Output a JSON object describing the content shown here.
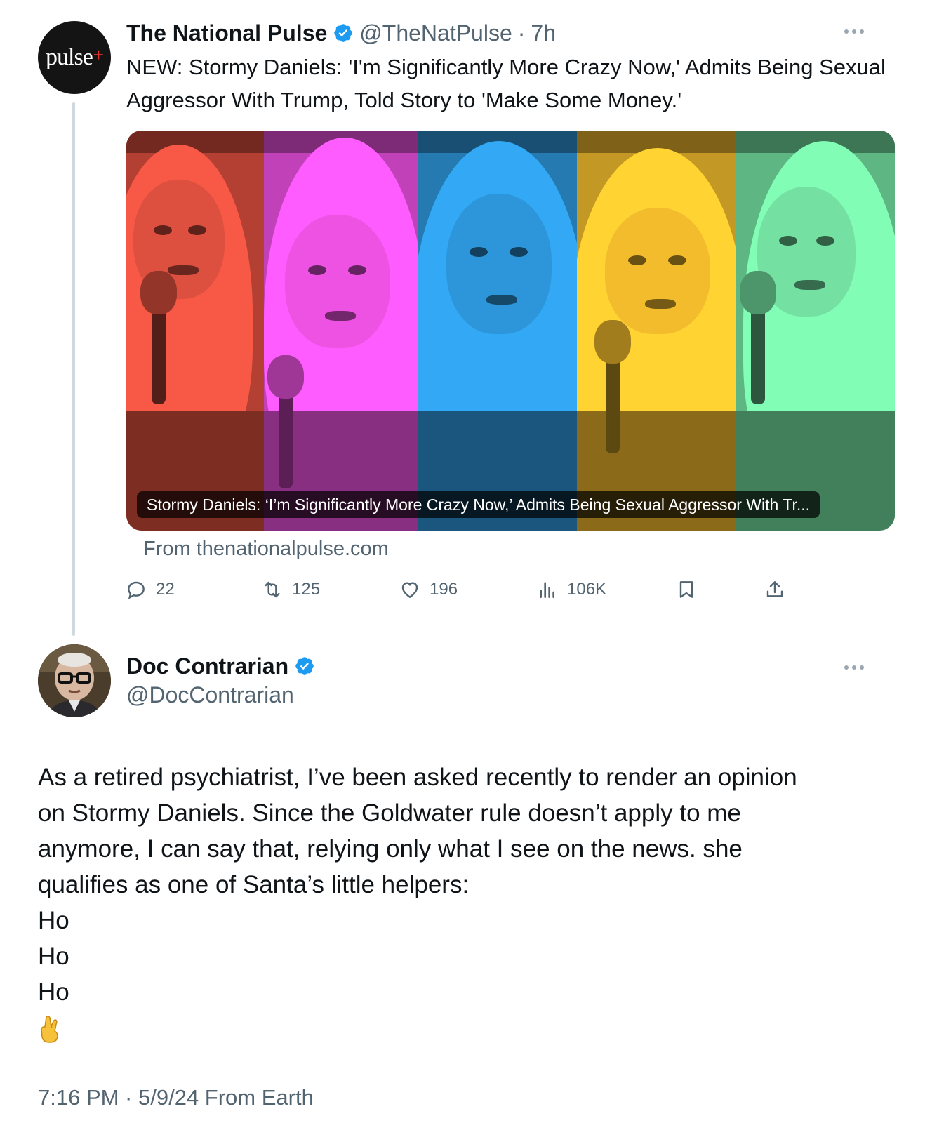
{
  "parent_tweet": {
    "avatar_text": "pulse",
    "avatar_plus": "+",
    "display_name": "The National Pulse",
    "handle": "@TheNatPulse",
    "separator": "·",
    "time": "7h",
    "text": "NEW: Stormy Daniels: 'I'm Significantly More Crazy Now,' Admits Being Sexual Aggressor With Trump, Told Story to 'Make Some Money.'",
    "card": {
      "caption": "Stormy Daniels: ‘I’m Significantly More Crazy Now,’ Admits Being Sexual Aggressor With Tr...",
      "source": "From thenationalpulse.com",
      "panel_colors": [
        "#d24b3b",
        "#e34ed8",
        "#2b8fd0",
        "#e7b32a",
        "#6ed69a"
      ]
    },
    "actions": {
      "replies": "22",
      "reposts": "125",
      "likes": "196",
      "views": "106K"
    }
  },
  "reply_tweet": {
    "display_name": "Doc Contrarian",
    "handle": "@DocContrarian",
    "lines": [
      "As a retired psychiatrist, I’ve been asked recently to render an opinion",
      "on Stormy Daniels. Since the Goldwater rule doesn’t apply to me",
      "anymore, I can say that, relying only what I see on the news. she",
      "qualifies as one of Santa’s little helpers:",
      "Ho",
      "Ho",
      "Ho"
    ],
    "emoji": "🤞",
    "timestamp": "7:16 PM · 5/9/24 From Earth"
  },
  "colors": {
    "verified_blue": "#1d9bf0",
    "muted_text": "#536471",
    "thread_line": "#cfd9de"
  },
  "icons": [
    "more-icon",
    "verified-icon",
    "reply-icon",
    "repost-icon",
    "like-icon",
    "views-icon",
    "bookmark-icon",
    "share-icon"
  ]
}
